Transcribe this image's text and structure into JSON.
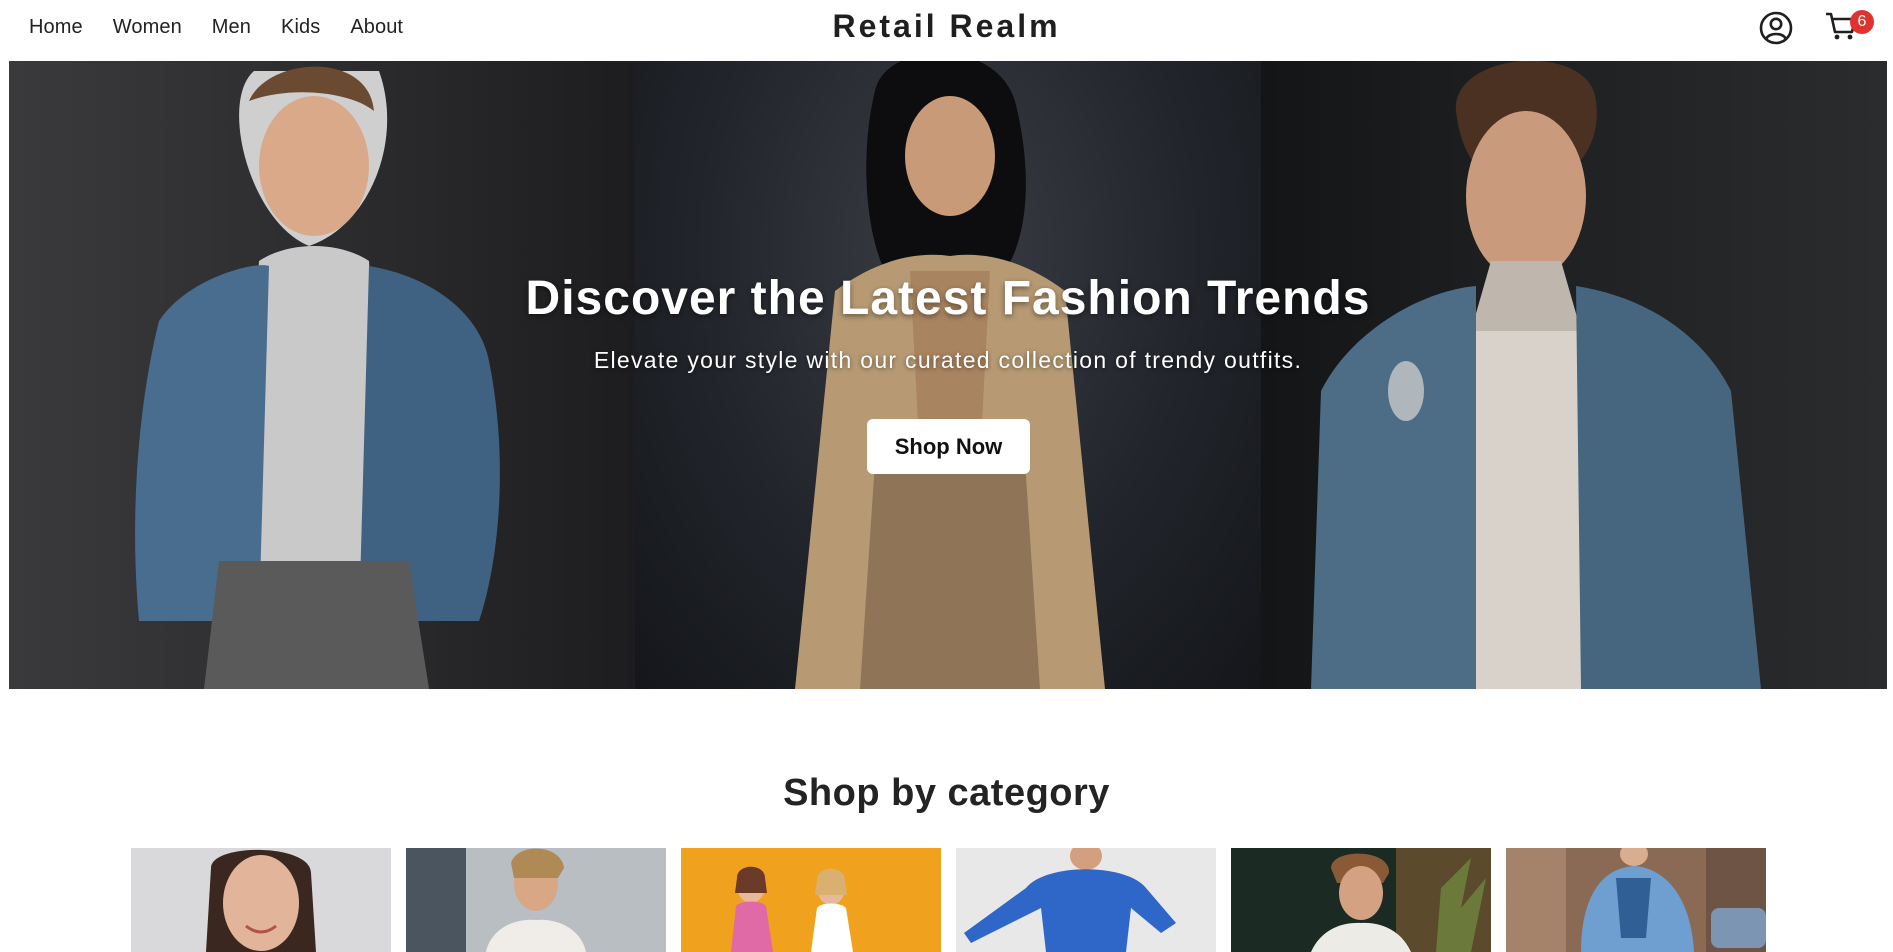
{
  "nav": {
    "links": [
      "Home",
      "Women",
      "Men",
      "Kids",
      "About"
    ],
    "brand": "Retail Realm",
    "cart_count": "6",
    "icons": {
      "account": "user-circle-icon",
      "cart": "shopping-cart-icon"
    }
  },
  "hero": {
    "title": "Discover the Latest Fashion Trends",
    "subtitle": "Elevate your style with our curated collection of trendy outfits.",
    "cta_label": "Shop Now"
  },
  "categories": {
    "title": "Shop by category",
    "items": [
      {
        "name": "woman-portrait",
        "bg": "#d9d9db"
      },
      {
        "name": "man-white-jacket",
        "bg": "#6f7a84"
      },
      {
        "name": "two-women-yellow",
        "bg": "#f0a21f"
      },
      {
        "name": "blue-sweatshirt",
        "bg": "#e7e7e7"
      },
      {
        "name": "man-dark-green",
        "bg": "#1d2a22"
      },
      {
        "name": "denim-jacket-street",
        "bg": "#8a6a55"
      }
    ]
  },
  "colors": {
    "badge": "#e0332e",
    "text": "#222222",
    "hero_text": "#ffffff"
  }
}
